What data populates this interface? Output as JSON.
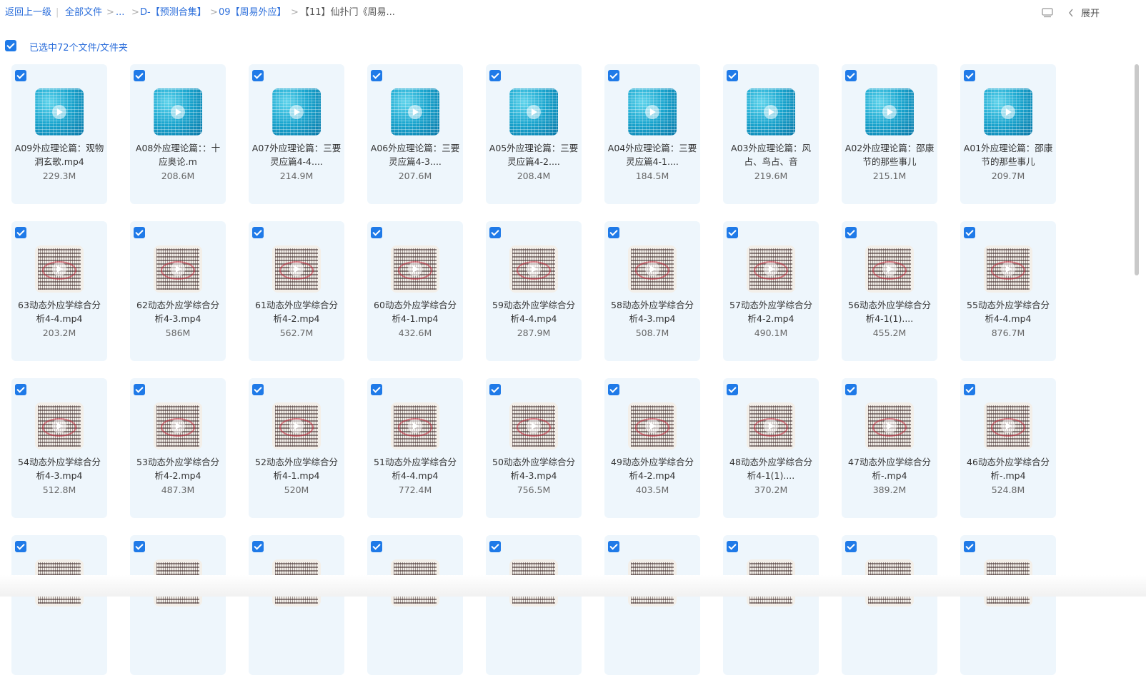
{
  "breadcrumb": {
    "back": "返回上一级",
    "divider": "|",
    "all_files": "全部文件",
    "ellipsis": "...",
    "folder1": "D-【预测合集】",
    "folder2": "09【周易外应】",
    "current": "【11】仙扑门《周易...",
    "sep": ">"
  },
  "topright": {
    "expand_label": "展开"
  },
  "selection": {
    "label": "已选中72个文件/文件夹"
  },
  "files": [
    {
      "name": "A09外应理论篇：观物洞玄歌.mp4",
      "size": "229.3M",
      "thumb": "video"
    },
    {
      "name": "A08外应理论篇：：十应奥论.m",
      "size": "208.6M",
      "thumb": "video"
    },
    {
      "name": "A07外应理论篇：三要灵应篇4-4....",
      "size": "214.9M",
      "thumb": "video"
    },
    {
      "name": "A06外应理论篇：三要灵应篇4-3....",
      "size": "207.6M",
      "thumb": "video"
    },
    {
      "name": "A05外应理论篇：三要灵应篇4-2....",
      "size": "208.4M",
      "thumb": "video"
    },
    {
      "name": "A04外应理论篇：三要灵应篇4-1....",
      "size": "184.5M",
      "thumb": "video"
    },
    {
      "name": "A03外应理论篇：风占、鸟占、音",
      "size": "219.6M",
      "thumb": "video"
    },
    {
      "name": "A02外应理论篇：邵康节的那些事儿",
      "size": "215.1M",
      "thumb": "video"
    },
    {
      "name": "A01外应理论篇：邵康节的那些事儿",
      "size": "209.7M",
      "thumb": "video"
    },
    {
      "name": "63动态外应学综合分析4-4.mp4",
      "size": "203.2M",
      "thumb": "doc"
    },
    {
      "name": "62动态外应学综合分析4-3.mp4",
      "size": "586M",
      "thumb": "doc"
    },
    {
      "name": "61动态外应学综合分析4-2.mp4",
      "size": "562.7M",
      "thumb": "doc"
    },
    {
      "name": "60动态外应学综合分析4-1.mp4",
      "size": "432.6M",
      "thumb": "doc"
    },
    {
      "name": "59动态外应学综合分析4-4.mp4",
      "size": "287.9M",
      "thumb": "doc"
    },
    {
      "name": "58动态外应学综合分析4-3.mp4",
      "size": "508.7M",
      "thumb": "doc"
    },
    {
      "name": "57动态外应学综合分析4-2.mp4",
      "size": "490.1M",
      "thumb": "doc"
    },
    {
      "name": "56动态外应学综合分析4-1(1)....",
      "size": "455.2M",
      "thumb": "doc"
    },
    {
      "name": "55动态外应学综合分析4-4.mp4",
      "size": "876.7M",
      "thumb": "doc"
    },
    {
      "name": "54动态外应学综合分析4-3.mp4",
      "size": "512.8M",
      "thumb": "doc"
    },
    {
      "name": "53动态外应学综合分析4-2.mp4",
      "size": "487.3M",
      "thumb": "doc"
    },
    {
      "name": "52动态外应学综合分析4-1.mp4",
      "size": "520M",
      "thumb": "doc"
    },
    {
      "name": "51动态外应学综合分析4-4.mp4",
      "size": "772.4M",
      "thumb": "doc"
    },
    {
      "name": "50动态外应学综合分析4-3.mp4",
      "size": "756.5M",
      "thumb": "doc"
    },
    {
      "name": "49动态外应学综合分析4-2.mp4",
      "size": "403.5M",
      "thumb": "doc"
    },
    {
      "name": "48动态外应学综合分析4-1(1)....",
      "size": "370.2M",
      "thumb": "doc"
    },
    {
      "name": "47动态外应学综合分析-.mp4",
      "size": "389.2M",
      "thumb": "doc"
    },
    {
      "name": "46动态外应学综合分析-.mp4",
      "size": "524.8M",
      "thumb": "doc"
    },
    {
      "name": "",
      "size": "",
      "thumb": "doc"
    },
    {
      "name": "",
      "size": "",
      "thumb": "doc"
    },
    {
      "name": "",
      "size": "",
      "thumb": "doc"
    },
    {
      "name": "",
      "size": "",
      "thumb": "doc"
    },
    {
      "name": "",
      "size": "",
      "thumb": "doc"
    },
    {
      "name": "",
      "size": "",
      "thumb": "doc"
    },
    {
      "name": "",
      "size": "",
      "thumb": "doc"
    },
    {
      "name": "",
      "size": "",
      "thumb": "doc"
    },
    {
      "name": "",
      "size": "",
      "thumb": "doc"
    }
  ],
  "colors": {
    "accent": "#1f7ae8",
    "link": "#2d6fdb",
    "card_bg": "#eef6fc"
  }
}
